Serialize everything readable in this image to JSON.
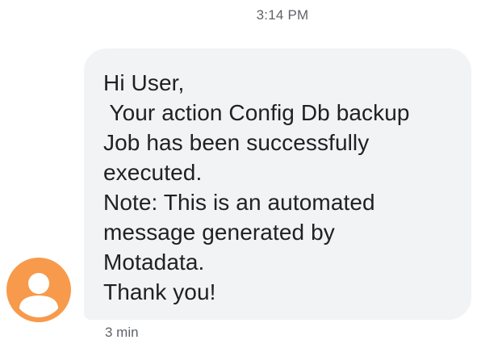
{
  "header": {
    "time": "3:14 PM"
  },
  "message": {
    "lines": [
      "Hi User,",
      " Your action Config Db backup",
      "Job has been successfully",
      "executed.",
      "Note: This is an automated",
      "message generated by",
      "Motadata.",
      "Thank you!"
    ],
    "age": "3 min"
  },
  "avatar": {
    "icon": "person-icon",
    "color": "#f79a4c"
  }
}
